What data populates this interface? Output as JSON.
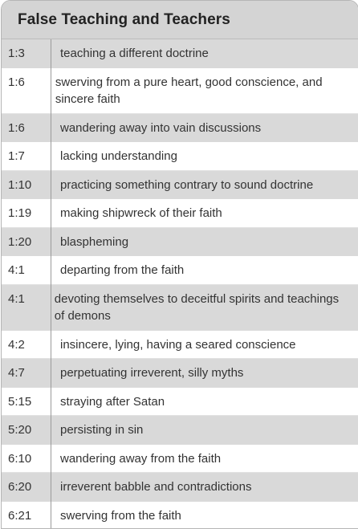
{
  "table": {
    "title": "False Teaching and Teachers",
    "rows": [
      {
        "ref": "1:3",
        "text": "teaching a different doctrine"
      },
      {
        "ref": "1:6",
        "text": "swerving from a pure heart, good conscience, and sincere faith"
      },
      {
        "ref": "1:6",
        "text": "wandering away into vain discussions"
      },
      {
        "ref": "1:7",
        "text": "lacking understanding"
      },
      {
        "ref": "1:10",
        "text": "practicing something contrary to sound doctrine"
      },
      {
        "ref": "1:19",
        "text": "making shipwreck of their faith"
      },
      {
        "ref": "1:20",
        "text": "blaspheming"
      },
      {
        "ref": "4:1",
        "text": "departing from the faith"
      },
      {
        "ref": "4:1",
        "text": "devoting themselves to deceitful spirits and teachings of demons"
      },
      {
        "ref": "4:2",
        "text": "insincere, lying, having a seared conscience"
      },
      {
        "ref": "4:7",
        "text": "perpetuating irreverent, silly myths"
      },
      {
        "ref": "5:15",
        "text": "straying after Satan"
      },
      {
        "ref": "5:20",
        "text": "persisting in sin"
      },
      {
        "ref": "6:10",
        "text": "wandering away from the faith"
      },
      {
        "ref": "6:20",
        "text": "irreverent babble and contradictions"
      },
      {
        "ref": "6:21",
        "text": "swerving from the faith"
      }
    ]
  },
  "colors": {
    "header_bg": "#d4d4d4",
    "shaded_row_bg": "#d9d9d9",
    "white_row_bg": "#ffffff",
    "text": "#333333",
    "divider": "#9a9a9a"
  }
}
